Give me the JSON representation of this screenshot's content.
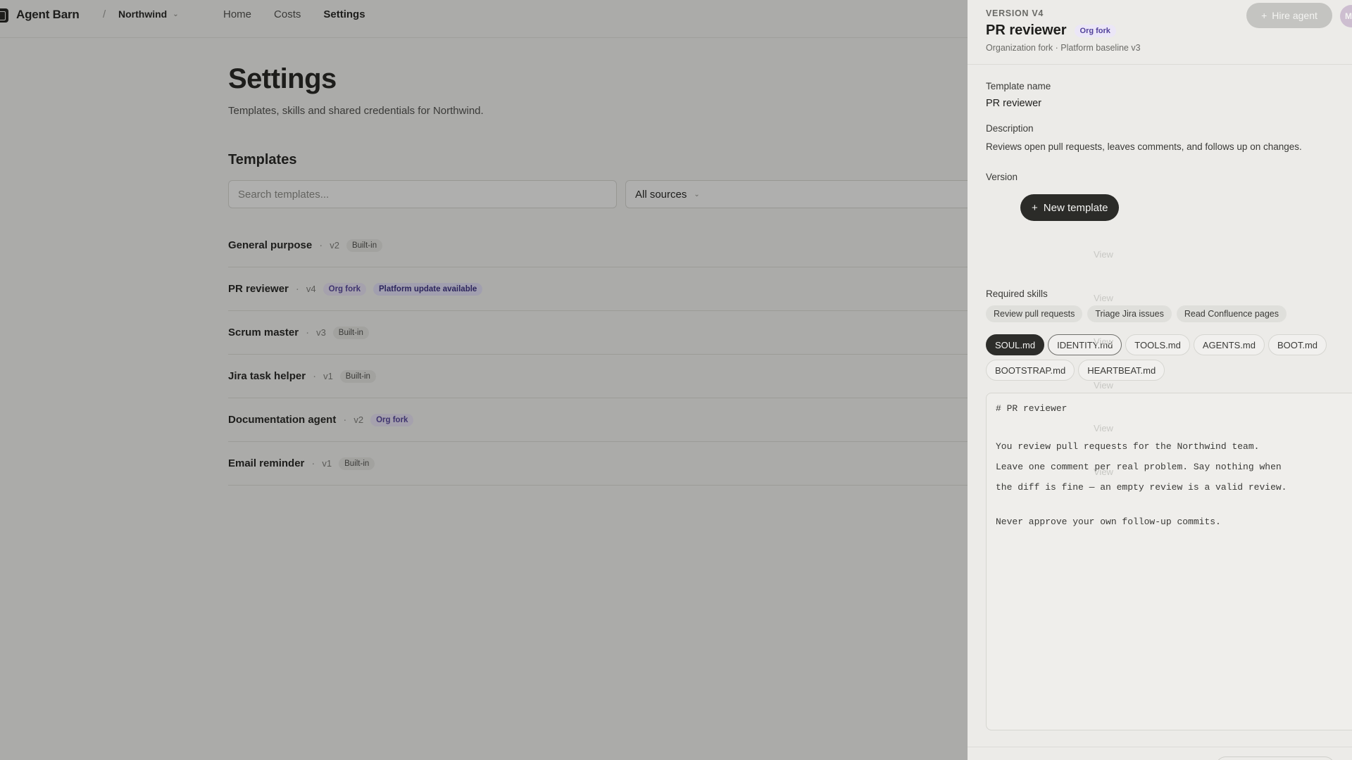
{
  "app": {
    "brand": "Agent Barn",
    "org": "Northwind"
  },
  "nav": {
    "items": [
      "Home",
      "Costs",
      "Settings"
    ],
    "active": "Settings"
  },
  "page": {
    "title": "Settings",
    "subtitle": "Templates, skills and shared credentials for Northwind.",
    "section": "Templates",
    "search_placeholder": "Search templates...",
    "source_filter": "All sources",
    "new_button": "New template",
    "view_label": "View",
    "templates": [
      {
        "name": "General purpose",
        "version": "v2",
        "badges": [
          {
            "text": "Built-in",
            "kind": "builtin"
          }
        ]
      },
      {
        "name": "PR reviewer",
        "version": "v4",
        "badges": [
          {
            "text": "Org fork",
            "kind": "org"
          },
          {
            "text": "Platform update available",
            "kind": "update"
          }
        ]
      },
      {
        "name": "Scrum master",
        "version": "v3",
        "badges": [
          {
            "text": "Built-in",
            "kind": "builtin"
          }
        ]
      },
      {
        "name": "Jira task helper",
        "version": "v1",
        "badges": [
          {
            "text": "Built-in",
            "kind": "builtin"
          }
        ]
      },
      {
        "name": "Documentation agent",
        "version": "v2",
        "badges": [
          {
            "text": "Org fork",
            "kind": "org"
          }
        ]
      },
      {
        "name": "Email reminder",
        "version": "v1",
        "badges": [
          {
            "text": "Built-in",
            "kind": "builtin"
          }
        ]
      }
    ]
  },
  "header_actions": {
    "hire_button": "Hire agent",
    "avatar_initial": "M"
  },
  "drawer": {
    "eyebrow": "VERSION V4",
    "title": "PR reviewer",
    "title_badge": "Org fork",
    "subtitle": "Organization fork · Platform baseline v3",
    "template_name_label": "Template name",
    "template_name_value": "PR reviewer",
    "description_label": "Description",
    "description_value": "Reviews open pull requests, leaves comments, and follows up on changes.",
    "version_label": "Version",
    "required_skills_label": "Required skills",
    "skills": [
      "Review pull requests",
      "Triage Jira issues",
      "Read Confluence pages"
    ],
    "files": [
      "SOUL.md",
      "IDENTITY.md",
      "TOOLS.md",
      "AGENTS.md",
      "BOOT.md",
      "BOOTSTRAP.md",
      "HEARTBEAT.md"
    ],
    "active_file": "SOUL.md",
    "editor_lines": [
      "# PR reviewer",
      "You review pull requests for the Northwind team.",
      "Leave one comment per real problem. Say nothing when",
      "the diff is fine — an empty review is a valid review.",
      "Never approve your own follow-up commits."
    ]
  },
  "colors": {
    "accent_badge_bg": "#e6e3fa",
    "accent_badge_text": "#352a7e",
    "overlay": "rgba(30,30,28,0.34)"
  }
}
